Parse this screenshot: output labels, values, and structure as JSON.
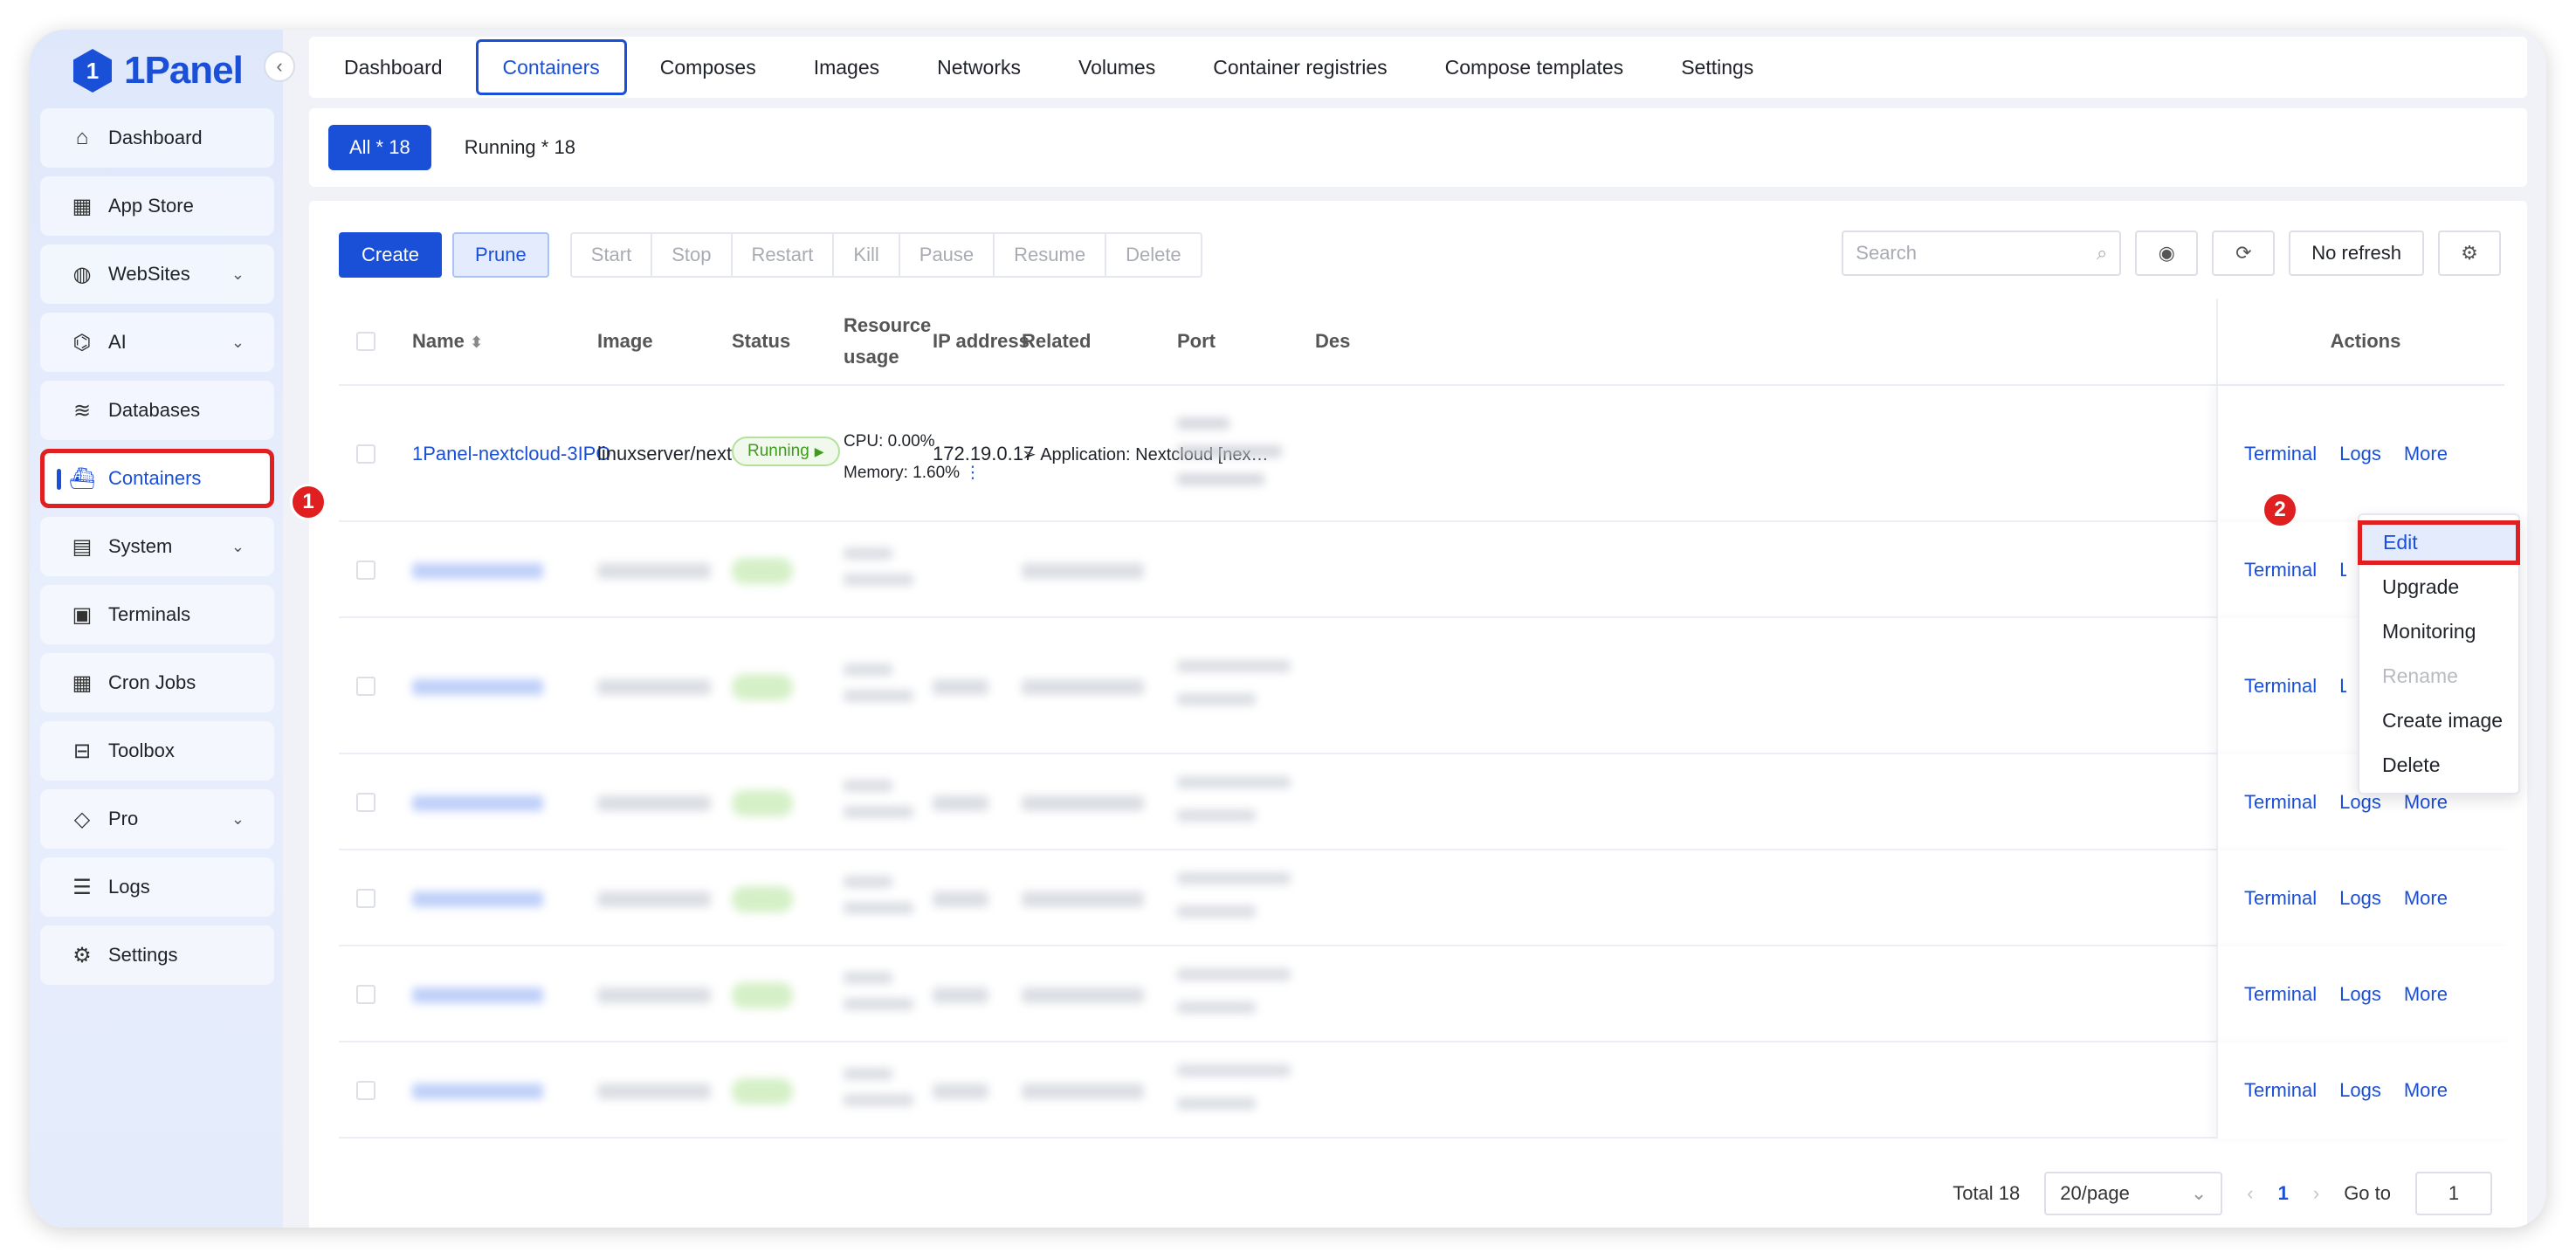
{
  "logo": {
    "text": "1Panel",
    "mark": "1"
  },
  "sidebar": {
    "items": [
      {
        "label": "Dashboard",
        "icon": "home-icon",
        "glyph": "⌂",
        "chevron": false
      },
      {
        "label": "App Store",
        "icon": "grid-icon",
        "glyph": "▦",
        "chevron": false
      },
      {
        "label": "WebSites",
        "icon": "globe-icon",
        "glyph": "◍",
        "chevron": true
      },
      {
        "label": "AI",
        "icon": "robot-icon",
        "glyph": "⌬",
        "chevron": true
      },
      {
        "label": "Databases",
        "icon": "layers-icon",
        "glyph": "≋",
        "chevron": false
      },
      {
        "label": "Containers",
        "icon": "docker-whale-icon",
        "glyph": "⛴",
        "chevron": false,
        "active": true
      },
      {
        "label": "System",
        "icon": "server-icon",
        "glyph": "▤",
        "chevron": true
      },
      {
        "label": "Terminals",
        "icon": "terminal-icon",
        "glyph": "▣",
        "chevron": false
      },
      {
        "label": "Cron Jobs",
        "icon": "calendar-icon",
        "glyph": "▦",
        "chevron": false
      },
      {
        "label": "Toolbox",
        "icon": "toolbox-icon",
        "glyph": "⊟",
        "chevron": false
      },
      {
        "label": "Pro",
        "icon": "diamond-icon",
        "glyph": "◇",
        "chevron": true
      },
      {
        "label": "Logs",
        "icon": "log-icon",
        "glyph": "☰",
        "chevron": false
      },
      {
        "label": "Settings",
        "icon": "gear-icon",
        "glyph": "⚙",
        "chevron": false
      }
    ]
  },
  "annotations": {
    "one": "1",
    "two": "2"
  },
  "tabs": [
    "Dashboard",
    "Containers",
    "Composes",
    "Images",
    "Networks",
    "Volumes",
    "Container registries",
    "Compose templates",
    "Settings"
  ],
  "filters": {
    "all": "All * 18",
    "running": "Running * 18"
  },
  "toolbar": {
    "create": "Create",
    "prune": "Prune",
    "group": [
      "Start",
      "Stop",
      "Restart",
      "Kill",
      "Pause",
      "Resume",
      "Delete"
    ],
    "search_placeholder": "Search",
    "refresh": "No refresh"
  },
  "table": {
    "headers": {
      "name": "Name",
      "image": "Image",
      "status": "Status",
      "resource": "Resource usage",
      "ip": "IP address",
      "related": "Related",
      "port": "Port",
      "desc": "Des",
      "actions": "Actions"
    },
    "first_row": {
      "name": "1Panel-nextcloud-3IPO",
      "image": "linuxserver/nextcloud:…",
      "status": "Running",
      "cpu": "CPU: 0.00%",
      "memory": "Memory: 1.60%",
      "ip": "172.19.0.17",
      "related": "Application: Nextcloud [nex…"
    },
    "action_labels": {
      "terminal": "Terminal",
      "logs": "Logs",
      "more": "More"
    }
  },
  "dropdown": [
    "Edit",
    "Upgrade",
    "Monitoring",
    "Rename",
    "Create image",
    "Delete"
  ],
  "pagination": {
    "total": "Total 18",
    "page_size": "20/page",
    "current": "1",
    "goto_label": "Go to",
    "goto_value": "1"
  }
}
